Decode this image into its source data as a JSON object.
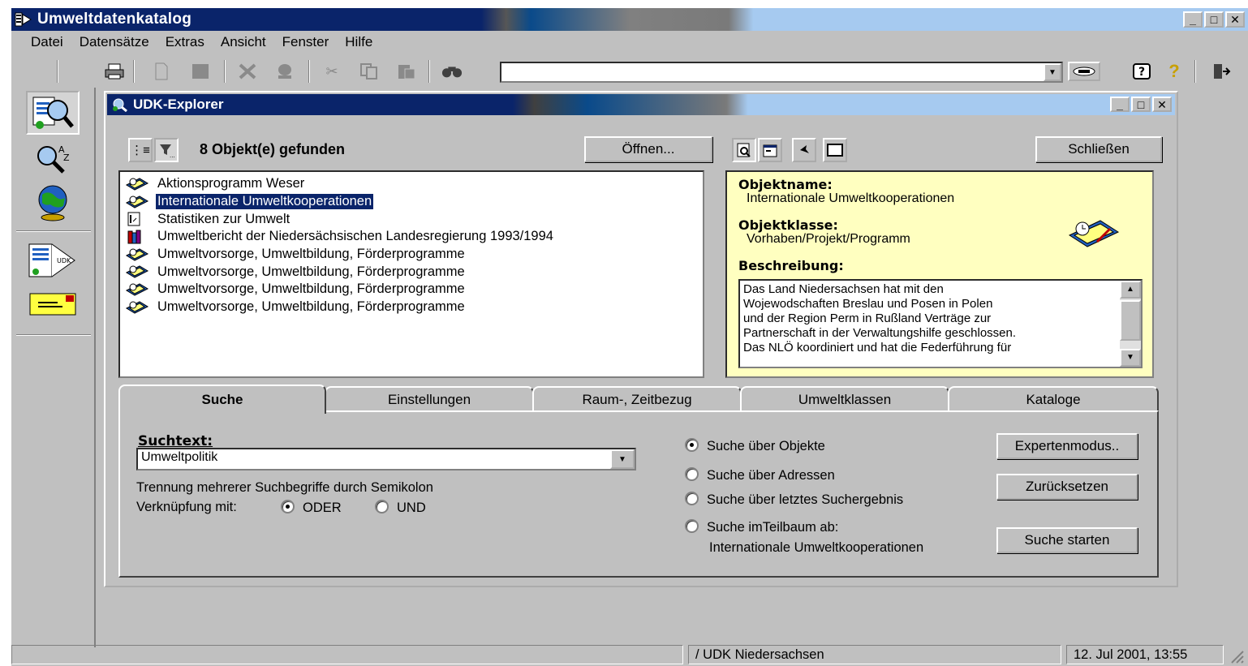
{
  "app": {
    "title": "Umweltdatenkatalog"
  },
  "menu": [
    {
      "label": "Datei"
    },
    {
      "label": "Datensätze"
    },
    {
      "label": "Extras"
    },
    {
      "label": "Ansicht"
    },
    {
      "label": "Fenster"
    },
    {
      "label": "Hilfe"
    }
  ],
  "toolbar": {
    "address_value": "",
    "icons": [
      "print-icon",
      "new-document-icon",
      "save-icon",
      "delete-icon",
      "stamp-icon",
      "cut-icon",
      "copy-icon",
      "paste-icon",
      "find-icon",
      "help-icon",
      "whats-this-icon",
      "exit-icon"
    ]
  },
  "explorer": {
    "title": "UDK-Explorer",
    "found_text": "8 Objekt(e) gefunden",
    "open_button": "Öffnen...",
    "close_button": "Schließen",
    "results": [
      {
        "label": "Aktionsprogramm Weser",
        "icon": "project-icon"
      },
      {
        "label": "Internationale Umweltkooperationen",
        "icon": "project-icon",
        "selected": true
      },
      {
        "label": "Statistiken zur Umwelt",
        "icon": "document-icon"
      },
      {
        "label": "Umweltbericht der Niedersächsischen Landesregierung 1993/1994",
        "icon": "books-icon"
      },
      {
        "label": "Umweltvorsorge, Umweltbildung, Förderprogramme",
        "icon": "project-icon"
      },
      {
        "label": "Umweltvorsorge, Umweltbildung, Förderprogramme",
        "icon": "project-icon"
      },
      {
        "label": "Umweltvorsorge, Umweltbildung, Förderprogramme",
        "icon": "project-icon"
      },
      {
        "label": "Umweltvorsorge, Umweltbildung, Förderprogramme",
        "icon": "project-icon"
      }
    ],
    "details": {
      "name_label": "Objektname:",
      "name_value": "Internationale Umweltkooperationen",
      "class_label": "Objektklasse:",
      "class_value": "Vorhaben/Projekt/Programm",
      "desc_label": "Beschreibung:",
      "desc_lines": [
        "Das Land Niedersachsen hat mit den",
        "Wojewodschaften Breslau und Posen in Polen",
        "und der Region Perm in Rußland Verträge zur",
        "Partnerschaft in der Verwaltungshilfe geschlossen.",
        "Das NLÖ koordiniert und hat die Federführung für"
      ]
    },
    "tabs": [
      {
        "label": "Suche",
        "active": true
      },
      {
        "label": "Einstellungen"
      },
      {
        "label": "Raum-, Zeitbezug"
      },
      {
        "label": "Umweltklassen"
      },
      {
        "label": "Kataloge"
      }
    ],
    "search": {
      "label": "Suchtext:",
      "value": "Umweltpolitik",
      "hint": "Trennung mehrerer Suchbegriffe durch Semikolon",
      "link_label": "Verknüpfung mit:",
      "or_label": "ODER",
      "and_label": "UND",
      "scope_objects": "Suche über Objekte",
      "scope_addresses": "Suche über Adressen",
      "scope_last": "Suche über letztes Suchergebnis",
      "scope_subtree": "Suche imTeilbaum ab:",
      "subtree_value": "Internationale Umweltkooperationen",
      "expert_button": "Expertenmodus..",
      "reset_button": "Zurücksetzen",
      "start_button": "Suche starten"
    }
  },
  "statusbar": {
    "panel1": "",
    "panel2": "/ UDK Niedersachsen",
    "panel3": "12. Jul 2001, 13:55"
  }
}
